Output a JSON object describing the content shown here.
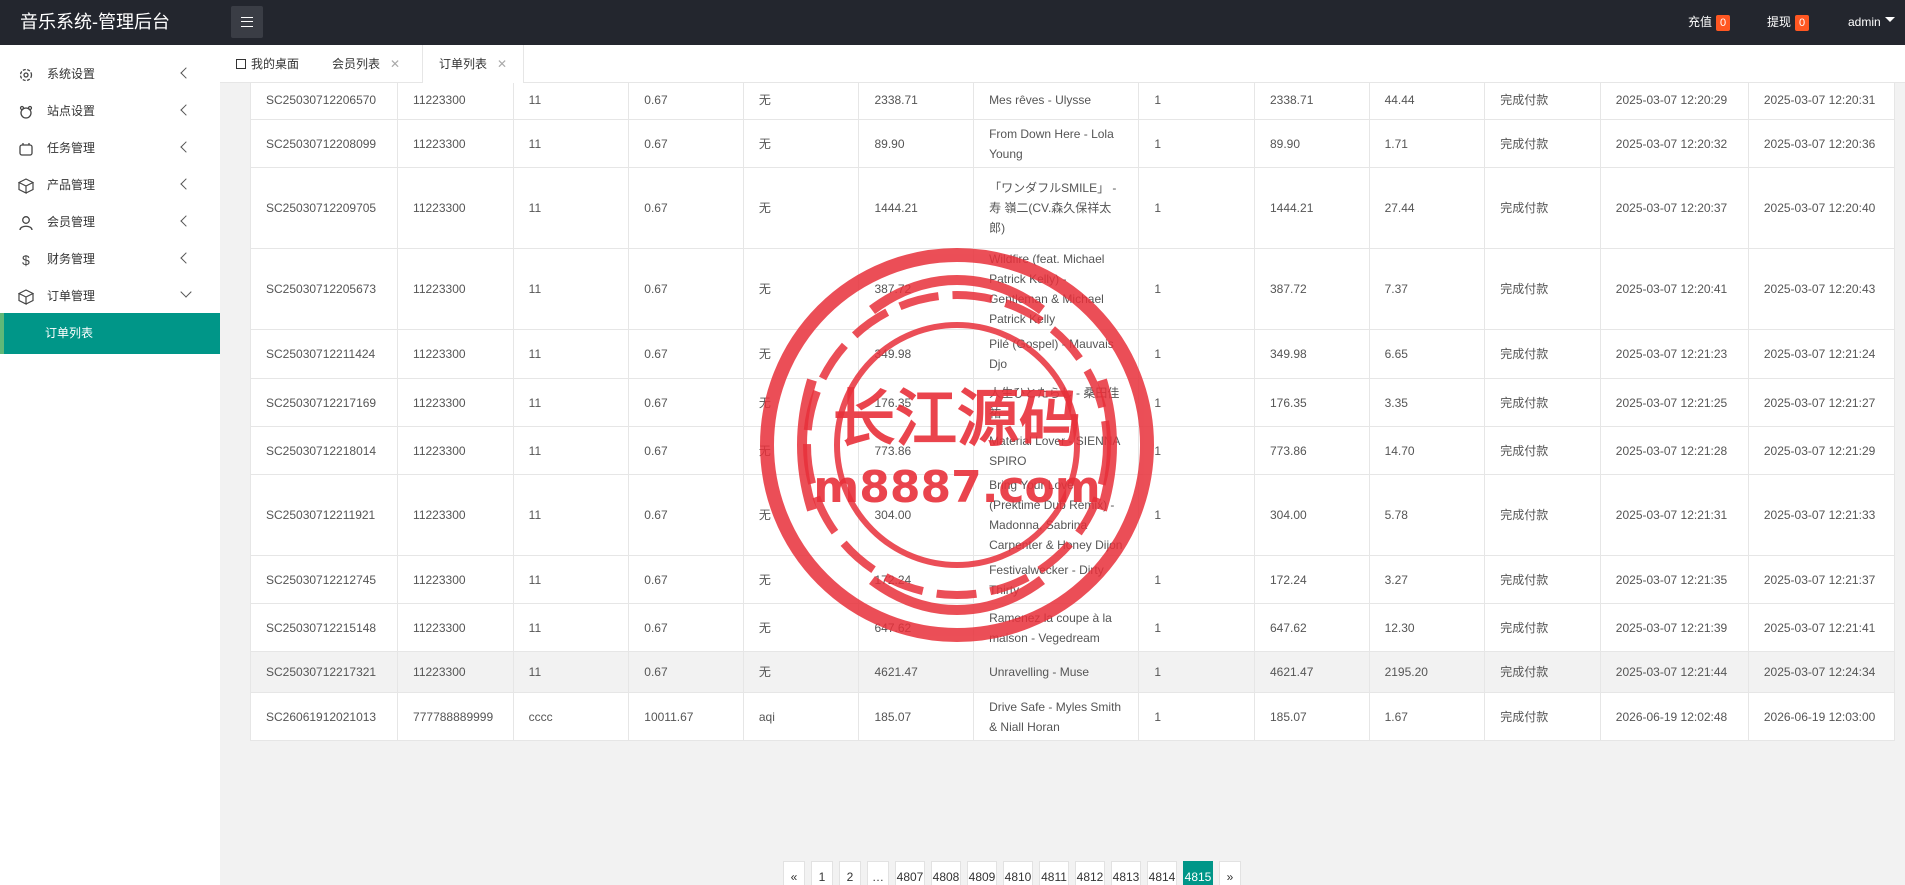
{
  "app": {
    "title": "音乐系统-管理后台"
  },
  "header": {
    "recharge_label": "充值",
    "recharge_count": "0",
    "withdraw_label": "提现",
    "withdraw_count": "0",
    "user": "admin"
  },
  "sidebar": {
    "items": [
      {
        "label": "系统设置",
        "icon": "gear-icon"
      },
      {
        "label": "站点设置",
        "icon": "site-icon"
      },
      {
        "label": "任务管理",
        "icon": "task-icon"
      },
      {
        "label": "产品管理",
        "icon": "product-icon"
      },
      {
        "label": "会员管理",
        "icon": "user-icon"
      },
      {
        "label": "财务管理",
        "icon": "dollar-icon"
      },
      {
        "label": "订单管理",
        "icon": "order-icon"
      }
    ],
    "active_sub": "订单列表"
  },
  "tabs": {
    "home": "我的桌面",
    "members": "会员列表",
    "orders": "订单列表",
    "close": "✕"
  },
  "table": {
    "rows": [
      [
        "SC25030712206570",
        "11223300",
        "11",
        "0.67",
        "无",
        "2338.71",
        "Mes rêves - Ulysse",
        "1",
        "2338.71",
        "44.44",
        "完成付款",
        "2025-03-07 12:20:29",
        "2025-03-07 12:20:31"
      ],
      [
        "SC25030712208099",
        "11223300",
        "11",
        "0.67",
        "无",
        "89.90",
        "From Down Here - Lola Young",
        "1",
        "89.90",
        "1.71",
        "完成付款",
        "2025-03-07 12:20:32",
        "2025-03-07 12:20:36"
      ],
      [
        "SC25030712209705",
        "11223300",
        "11",
        "0.67",
        "无",
        "1444.21",
        "「ワンダフルSMILE」 - 寿 嶺二(CV.森久保祥太郎)",
        "1",
        "1444.21",
        "27.44",
        "完成付款",
        "2025-03-07 12:20:37",
        "2025-03-07 12:20:40"
      ],
      [
        "SC25030712205673",
        "11223300",
        "11",
        "0.67",
        "无",
        "387.72",
        "Wildfire (feat. Michael Patrick Kelly) - Gentleman & Michael Patrick Kelly",
        "1",
        "387.72",
        "7.37",
        "完成付款",
        "2025-03-07 12:20:41",
        "2025-03-07 12:20:43"
      ],
      [
        "SC25030712211424",
        "11223300",
        "11",
        "0.67",
        "无",
        "349.98",
        "Pilé (Gospel) - Mauvais Djo",
        "1",
        "349.98",
        "6.65",
        "完成付款",
        "2025-03-07 12:21:23",
        "2025-03-07 12:21:24"
      ],
      [
        "SC25030712217169",
        "11223300",
        "11",
        "0.67",
        "无",
        "176.35",
        "人生ひとたらし - 桑田佳祐",
        "1",
        "176.35",
        "3.35",
        "完成付款",
        "2025-03-07 12:21:25",
        "2025-03-07 12:21:27"
      ],
      [
        "SC25030712218014",
        "11223300",
        "11",
        "0.67",
        "无",
        "773.86",
        "Material Lover - SIENNA SPIRO",
        "1",
        "773.86",
        "14.70",
        "完成付款",
        "2025-03-07 12:21:28",
        "2025-03-07 12:21:29"
      ],
      [
        "SC25030712211921",
        "11223300",
        "11",
        "0.67",
        "无",
        "304.00",
        "Bring Your Love (Prektime Dub Remix) - Madonna, Sabrina Carpenter & Honey Dijon",
        "1",
        "304.00",
        "5.78",
        "完成付款",
        "2025-03-07 12:21:31",
        "2025-03-07 12:21:33"
      ],
      [
        "SC25030712212745",
        "11223300",
        "11",
        "0.67",
        "无",
        "172.24",
        "Festivalwecker - Dirty Thirty",
        "1",
        "172.24",
        "3.27",
        "完成付款",
        "2025-03-07 12:21:35",
        "2025-03-07 12:21:37"
      ],
      [
        "SC25030712215148",
        "11223300",
        "11",
        "0.67",
        "无",
        "647.62",
        "Ramenez la coupe à la maison - Vegedream",
        "1",
        "647.62",
        "12.30",
        "完成付款",
        "2025-03-07 12:21:39",
        "2025-03-07 12:21:41"
      ],
      [
        "SC25030712217321",
        "11223300",
        "11",
        "0.67",
        "无",
        "4621.47",
        "Unravelling - Muse",
        "1",
        "4621.47",
        "2195.20",
        "完成付款",
        "2025-03-07 12:21:44",
        "2025-03-07 12:24:34"
      ],
      [
        "SC26061912021013",
        "777788889999",
        "cccc",
        "10011.67",
        "aqi",
        "185.07",
        "Drive Safe - Myles Smith & Niall Horan",
        "1",
        "185.07",
        "1.67",
        "完成付款",
        "2026-06-19 12:02:48",
        "2026-06-19 12:03:00"
      ]
    ]
  },
  "pagination": {
    "prev": "«",
    "pages": [
      "1",
      "2",
      "…",
      "4807",
      "4808",
      "4809",
      "4810",
      "4811",
      "4812",
      "4813",
      "4814",
      "4815"
    ],
    "current": "4815",
    "next": "»"
  },
  "watermark": {
    "text_cn": "长江源码",
    "text_url": "m8887.com",
    "color": "#e8303a"
  },
  "colors": {
    "accent": "#009688",
    "topbar": "#23262e",
    "badge": "#ff5722"
  }
}
